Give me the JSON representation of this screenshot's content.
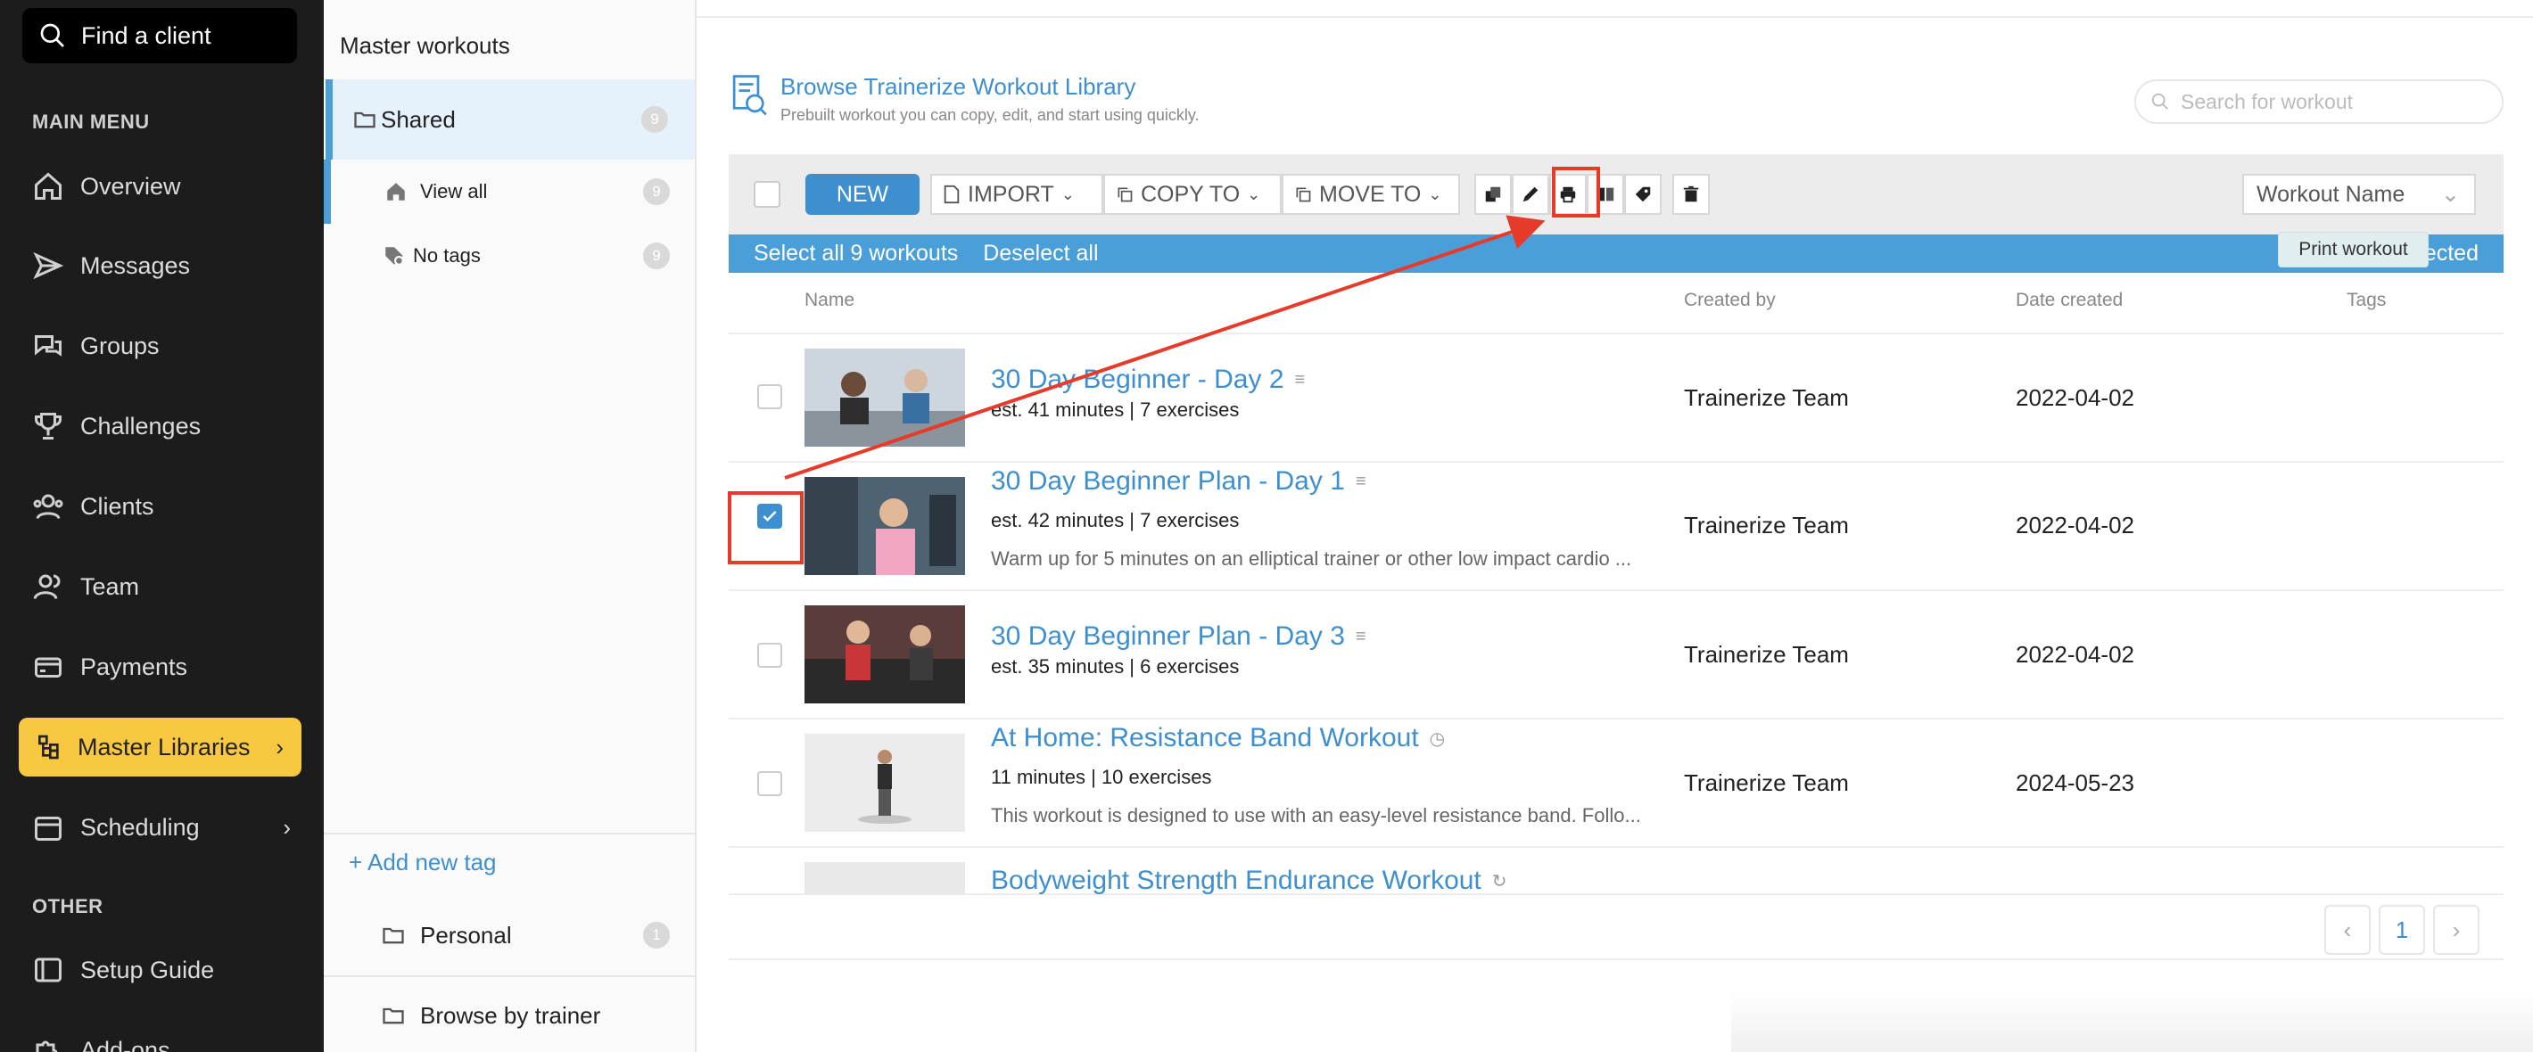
{
  "sidebar": {
    "search_label": "Find a client",
    "main_menu_label": "MAIN MENU",
    "items": [
      {
        "label": "Overview"
      },
      {
        "label": "Messages"
      },
      {
        "label": "Groups"
      },
      {
        "label": "Challenges"
      },
      {
        "label": "Clients"
      },
      {
        "label": "Team"
      },
      {
        "label": "Payments"
      },
      {
        "label": "Master Libraries"
      },
      {
        "label": "Scheduling"
      }
    ],
    "other_label": "OTHER",
    "other_items": [
      {
        "label": "Setup Guide"
      },
      {
        "label": "Add-ons"
      }
    ],
    "active_color": "#f8c940"
  },
  "folders": {
    "title": "Master workouts",
    "shared": {
      "label": "Shared",
      "count": "9"
    },
    "view_all": {
      "label": "View all",
      "count": "9"
    },
    "no_tags": {
      "label": "No tags",
      "count": "9"
    },
    "add_tag": "+ Add new tag",
    "personal": {
      "label": "Personal",
      "count": "1"
    },
    "browse_trainer": "Browse by trainer"
  },
  "main": {
    "browse_title": "Browse Trainerize Workout Library",
    "browse_sub": "Prebuilt workout you can copy, edit, and start using quickly.",
    "search_placeholder": "Search for workout",
    "toolbar": {
      "new": "NEW",
      "import": "IMPORT",
      "copy_to": "COPY TO",
      "move_to": "MOVE TO",
      "sort": "Workout Name",
      "tooltip": "Print workout"
    },
    "selection": {
      "select_all": "Select all 9 workouts",
      "deselect_all": "Deselect all",
      "selected": "1 workout selected"
    },
    "columns": {
      "name": "Name",
      "created_by": "Created by",
      "date_created": "Date created",
      "tags": "Tags"
    },
    "rows": [
      {
        "name": "30 Day Beginner - Day 2",
        "meta": "est. 41 minutes | 7 exercises",
        "desc": "",
        "created_by": "Trainerize Team",
        "date": "2022-04-02",
        "checked": false
      },
      {
        "name": "30 Day Beginner Plan - Day 1",
        "meta": "est. 42 minutes | 7 exercises",
        "desc": "Warm up for 5 minutes on an elliptical trainer or other low impact cardio ...",
        "created_by": "Trainerize Team",
        "date": "2022-04-02",
        "checked": true
      },
      {
        "name": "30 Day Beginner Plan - Day 3",
        "meta": "est. 35 minutes | 6 exercises",
        "desc": "",
        "created_by": "Trainerize Team",
        "date": "2022-04-02",
        "checked": false
      },
      {
        "name": "At Home: Resistance Band Workout",
        "meta": "11 minutes | 10 exercises",
        "desc": "This workout is designed to use with an easy-level resistance band. Follo...",
        "created_by": "Trainerize Team",
        "date": "2024-05-23",
        "checked": false
      },
      {
        "name": "Bodyweight Strength Endurance Workout",
        "meta": "",
        "desc": "",
        "created_by": "",
        "date": "",
        "checked": false
      }
    ],
    "page": "1",
    "accent": "#3d8fd0",
    "highlight": "#e63a2a"
  }
}
